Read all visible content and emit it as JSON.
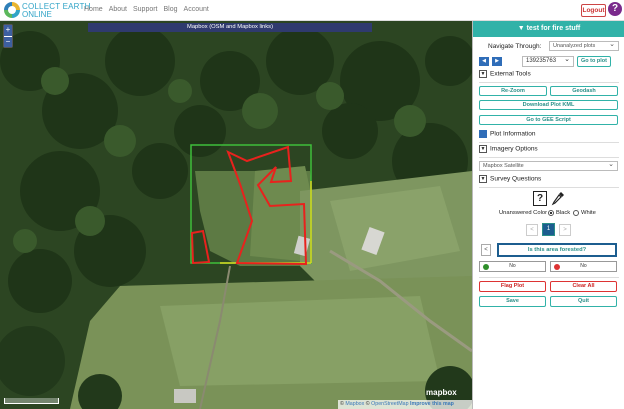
{
  "nav": {
    "logo_line1": "COLLECT EARTH",
    "logo_line2": "ONLINE",
    "links": [
      "Home",
      "About",
      "Support",
      "Blog",
      "Account"
    ],
    "logout_label": "Logout",
    "help_label": "?"
  },
  "map": {
    "imagery_title": "Mapbox (OSM and Mapbox links)",
    "zoom_in": "+",
    "zoom_out": "−",
    "attribution_copyright1": "©",
    "attribution_mapbox": "Mapbox",
    "attribution_copyright2": "©",
    "attribution_osm": "OpenStreetMap",
    "attribution_improve": "Improve this map",
    "brand": "mapbox"
  },
  "sidebar": {
    "title": "▼ test for fire stuff",
    "navigate_label": "Navigate Through:",
    "navigate_select": "Unanalyzed plots",
    "prev_icon": "◀",
    "next_icon": "▶",
    "plot_id": "139235763",
    "goto_plot_label": "Go to plot",
    "external_tools_label": "External Tools",
    "tools": [
      "Re-Zoom",
      "Geodash",
      "Download Plot KML",
      "Go to GEE Script"
    ],
    "plot_info_label": "Plot Information",
    "imagery_options_label": "Imagery Options",
    "imagery_select": "Mapbox Satellite",
    "survey_label": "Survey Questions",
    "unanswered_color_label": "Unanswered Color",
    "color_black": "Black",
    "color_white": "White",
    "page_prev": "<",
    "page_current": "1",
    "page_next": ">",
    "question_prev": "<",
    "question_text": "Is this area forested?",
    "answers": [
      "No",
      "No"
    ],
    "flag_plot_label": "Flag Plot",
    "clear_all_label": "Clear All",
    "save_label": "Save",
    "quit_label": "Quit"
  },
  "colors": {
    "accent": "#31b2a8",
    "danger": "#d33333",
    "nav_purple": "#7a2a8c",
    "imagery_bar": "#2f3a6e"
  }
}
